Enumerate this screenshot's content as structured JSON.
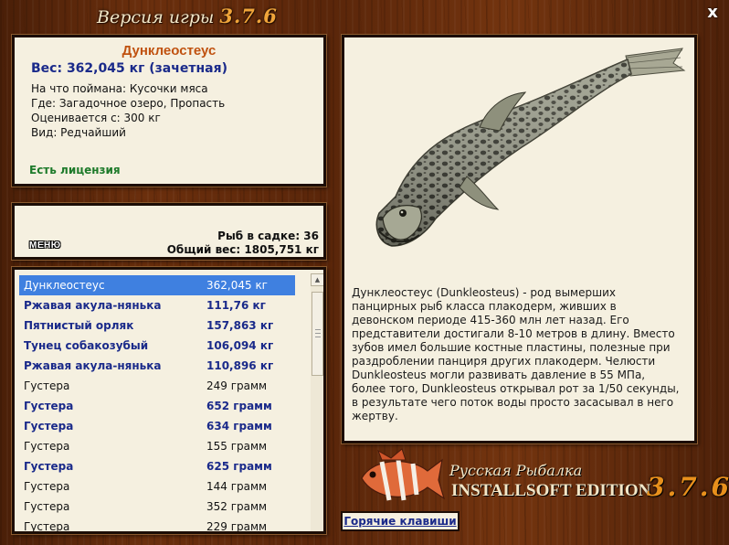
{
  "window": {
    "title": "Версия игры",
    "version": "3.7.6",
    "close_label": "x"
  },
  "fish_info": {
    "name": "Дунклеостеус",
    "weight": "Вес: 362,045 кг (зачетная)",
    "caught_on": "На что поймана: Кусочки мяса",
    "location": "Где: Загадочное озеро, Пропасть",
    "valued_from": "Оценивается с: 300 кг",
    "rarity": "Вид: Редчайший",
    "license": "Есть лицензия"
  },
  "stats": {
    "menu_label": "МЕНЮ",
    "fish_in_net": "Рыб в садке: 36",
    "total_weight": "Общий вес: 1805,751 кг"
  },
  "catch_list": [
    {
      "name": "Дунклеостеус",
      "weight": "362,045 кг",
      "style": "selected"
    },
    {
      "name": "Ржавая акула-нянька",
      "weight": "111,76 кг",
      "style": "trophy"
    },
    {
      "name": "Пятнистый орляк",
      "weight": "157,863 кг",
      "style": "trophy"
    },
    {
      "name": "Тунец собакозубый",
      "weight": "106,094 кг",
      "style": "trophy"
    },
    {
      "name": "Ржавая акула-нянька",
      "weight": "110,896 кг",
      "style": "trophy"
    },
    {
      "name": "Густера",
      "weight": "249 грамм",
      "style": "normal"
    },
    {
      "name": "Густера",
      "weight": "652 грамм",
      "style": "trophy"
    },
    {
      "name": "Густера",
      "weight": "634 грамм",
      "style": "trophy"
    },
    {
      "name": "Густера",
      "weight": "155 грамм",
      "style": "normal"
    },
    {
      "name": "Густера",
      "weight": "625 грамм",
      "style": "trophy"
    },
    {
      "name": "Густера",
      "weight": "144 грамм",
      "style": "normal"
    },
    {
      "name": "Густера",
      "weight": "352 грамм",
      "style": "normal"
    },
    {
      "name": "Густера",
      "weight": "229 грамм",
      "style": "normal"
    }
  ],
  "description": "Дунклеостеус (Dunkleosteus) - род вымерших панцирных рыб класса плакодерм, живших в девонском периоде 415-360 млн лет назад. Его представители достигали 8-10 метров в длину. Вместо зубов имел большие костные пластины, полезные при раздроблении панциря других плакодерм. Челюсти Dunkleosteus могли развивать давление в 55 МПа, более того, Dunkleosteus открывал рот за 1/50 секунды, в результате чего поток воды просто засасывал в него жертву.",
  "logo": {
    "line1": "Русская Рыбалка",
    "line2": "INSTALLSOFT EDITION",
    "version": "3.7.6"
  },
  "hotkeys_label": "Горячие клавиши",
  "colors": {
    "trophy": "#1a2a8a",
    "selected_bg": "#3f80e0",
    "fish_name": "#c05210",
    "license": "#1d7a2a",
    "version": "#e8901c"
  }
}
